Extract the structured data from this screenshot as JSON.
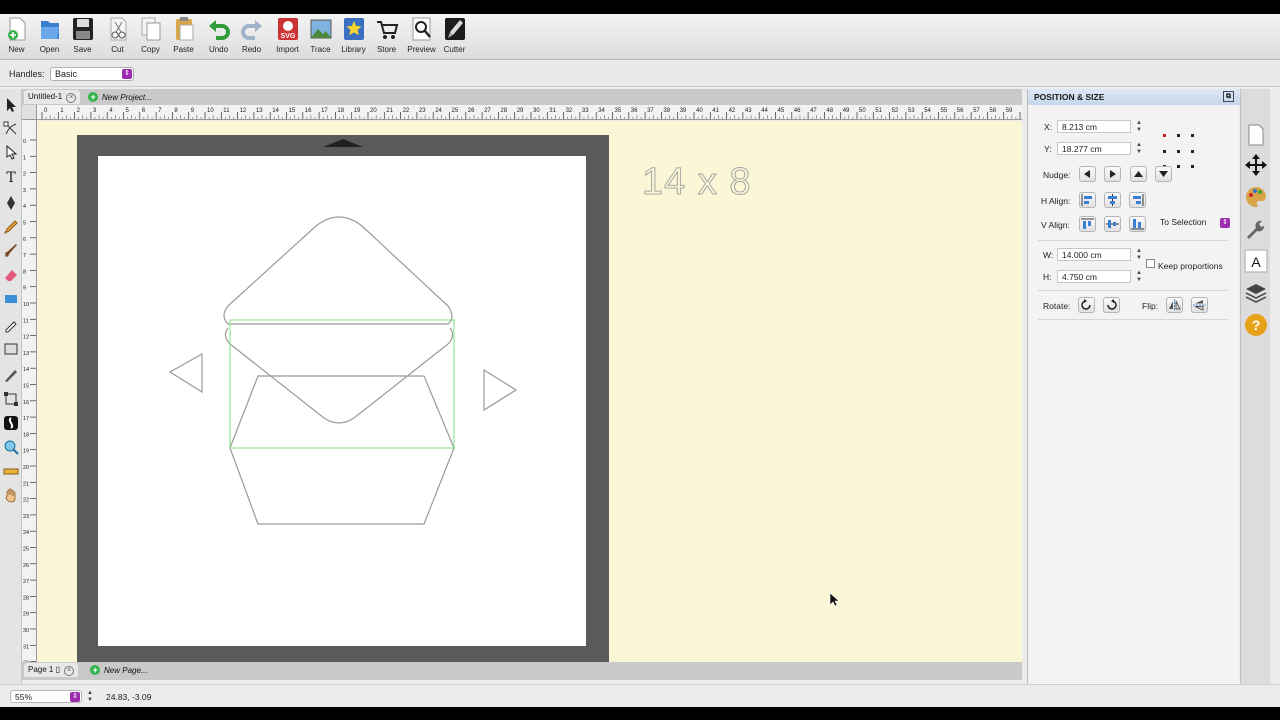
{
  "toolbar": {
    "items": [
      {
        "label": "New",
        "icon": "new-document-icon"
      },
      {
        "label": "Open",
        "icon": "open-folder-icon"
      },
      {
        "label": "Save",
        "icon": "floppy-disk-icon"
      },
      {
        "label": "Cut",
        "icon": "scissors-icon"
      },
      {
        "label": "Copy",
        "icon": "copy-icon"
      },
      {
        "label": "Paste",
        "icon": "clipboard-icon"
      },
      {
        "label": "Undo",
        "icon": "undo-arrow-icon"
      },
      {
        "label": "Redo",
        "icon": "redo-arrow-icon"
      },
      {
        "label": "Import",
        "icon": "svg-import-icon"
      },
      {
        "label": "Trace",
        "icon": "trace-image-icon"
      },
      {
        "label": "Library",
        "icon": "library-star-icon"
      },
      {
        "label": "Store",
        "icon": "shopping-cart-icon"
      },
      {
        "label": "Preview",
        "icon": "magnifier-preview-icon"
      },
      {
        "label": "Cutter",
        "icon": "cutter-knife-icon"
      }
    ]
  },
  "handles": {
    "label": "Handles:",
    "value": "Basic"
  },
  "tabs": [
    {
      "label": "Untitled-1"
    },
    {
      "label": "New Project..."
    }
  ],
  "canvas": {
    "overlay_text": "14 x 8"
  },
  "pages": [
    {
      "label": "Page 1"
    },
    {
      "label": "New Page..."
    }
  ],
  "panel": {
    "title": "POSITION & SIZE",
    "x_label": "X:",
    "x_value": "8.213 cm",
    "y_label": "Y:",
    "y_value": "18.277 cm",
    "nudge_label": "Nudge:",
    "halign_label": "H Align:",
    "valign_label": "V Align:",
    "align_target": "To Selection",
    "w_label": "W:",
    "w_value": "14.000 cm",
    "h_label": "H:",
    "h_value": "4.750 cm",
    "keep_proportions": "Keep proportions",
    "rotate_label": "Rotate:",
    "flip_label": "Flip:"
  },
  "status": {
    "zoom": "55%",
    "coords": "24.83, -3.09"
  },
  "colors": {
    "canvas_bg": "#fbf6d5",
    "mat": "#5a5a5a",
    "selection": "#7ee07e",
    "accent": "#9c2bb0"
  }
}
